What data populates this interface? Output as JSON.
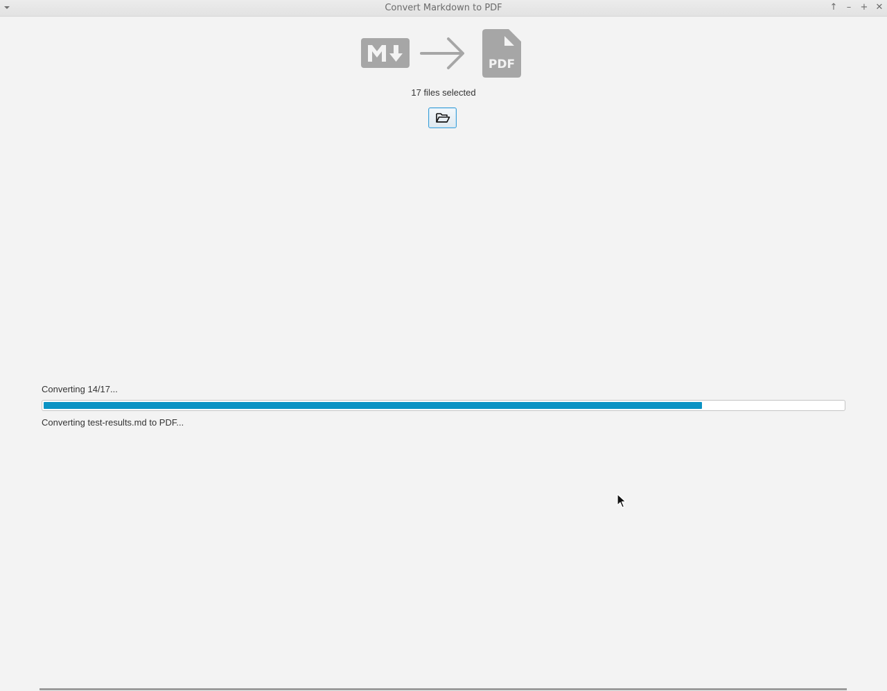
{
  "window": {
    "title": "Convert Markdown to PDF"
  },
  "titlebar_buttons": [
    {
      "icon": "up-arrow-icon",
      "glyph": "↑"
    },
    {
      "icon": "minimize-icon",
      "glyph": "–"
    },
    {
      "icon": "maximize-icon",
      "glyph": "+"
    },
    {
      "icon": "close-icon",
      "glyph": "✕"
    }
  ],
  "hero": {
    "source_icon": "markdown-icon",
    "arrow_icon": "arrow-right-icon",
    "target_icon": "pdf-file-icon",
    "pdf_label": "PDF",
    "md_label": "M",
    "icon_color": "#a6a6a6"
  },
  "selection": {
    "files_selected": "17 files selected",
    "open_button_icon": "folder-open-icon"
  },
  "progress": {
    "status_top": "Converting 14/17...",
    "status_bottom": "Converting test-results.md to PDF...",
    "fraction": 0.8235,
    "bar_color": "#0b93c4"
  }
}
